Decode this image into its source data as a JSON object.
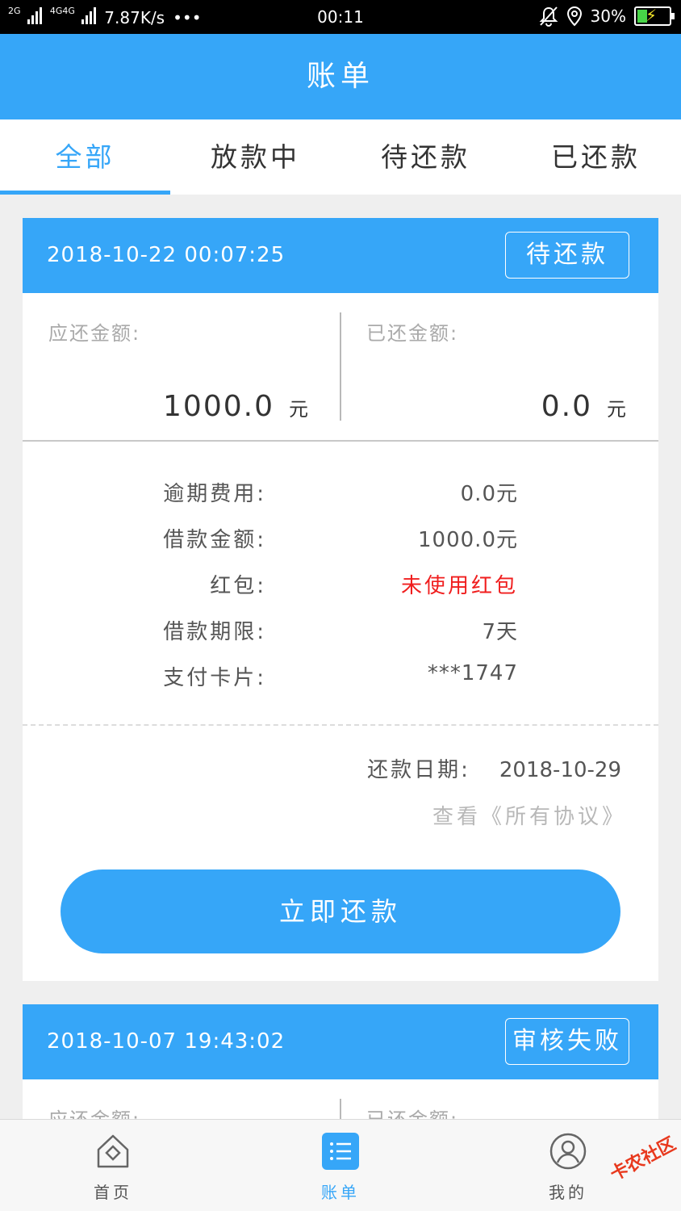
{
  "status_bar": {
    "net1": "2G",
    "net2": "4G4G",
    "speed": "7.87K/s",
    "more": "•••",
    "time": "00:11",
    "battery": "30%",
    "icons": [
      "silent-bell-icon",
      "location-icon",
      "battery-charging-icon"
    ]
  },
  "header": {
    "title": "账单"
  },
  "tabs": [
    {
      "label": "全部",
      "active": true
    },
    {
      "label": "放款中",
      "active": false
    },
    {
      "label": "待还款",
      "active": false
    },
    {
      "label": "已还款",
      "active": false
    }
  ],
  "bills": [
    {
      "datetime": "2018-10-22 00:07:25",
      "status": "待还款",
      "due_label": "应还金额:",
      "due_value": "1000.0",
      "due_unit": "元",
      "paid_label": "已还金额:",
      "paid_value": "0.0",
      "paid_unit": "元",
      "details": [
        {
          "key": "逾期费用:",
          "value": "0.0元"
        },
        {
          "key": "借款金额:",
          "value": "1000.0元"
        },
        {
          "key": "红包:",
          "value": "未使用红包",
          "highlight": "#f01e1e"
        },
        {
          "key": "借款期限:",
          "value": "7天"
        },
        {
          "key": "支付卡片:",
          "value": "***1747"
        }
      ],
      "repay_date_label": "还款日期:",
      "repay_date": "2018-10-29",
      "protocol_link": "查看《所有协议》",
      "repay_button": "立即还款"
    },
    {
      "datetime": "2018-10-07 19:43:02",
      "status": "审核失败",
      "due_label": "应还金额:",
      "paid_label": "已还金额:"
    }
  ],
  "bottom_nav": [
    {
      "label": "首页",
      "icon": "home-icon",
      "active": false
    },
    {
      "label": "账单",
      "icon": "list-icon",
      "active": true
    },
    {
      "label": "我的",
      "icon": "user-icon",
      "active": false
    }
  ],
  "watermark": "卡农社区",
  "colors": {
    "primary": "#36a6f8",
    "highlight": "#f01e1e",
    "background": "#efefef"
  }
}
